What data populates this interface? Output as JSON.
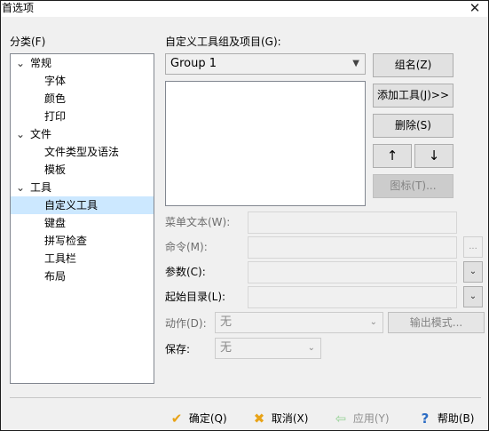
{
  "window": {
    "title": "首选项",
    "close_glyph": "✕"
  },
  "category": {
    "label": "分类(F)",
    "tree": [
      {
        "label": "常规",
        "expanded": true,
        "level": 0
      },
      {
        "label": "字体",
        "level": 1
      },
      {
        "label": "颜色",
        "level": 1
      },
      {
        "label": "打印",
        "level": 1
      },
      {
        "label": "文件",
        "expanded": true,
        "level": 0
      },
      {
        "label": "文件类型及语法",
        "level": 1
      },
      {
        "label": "模板",
        "level": 1
      },
      {
        "label": "工具",
        "expanded": true,
        "level": 0
      },
      {
        "label": "自定义工具",
        "level": 1,
        "selected": true
      },
      {
        "label": "键盘",
        "level": 1
      },
      {
        "label": "拼写检查",
        "level": 1
      },
      {
        "label": "工具栏",
        "level": 1
      },
      {
        "label": "布局",
        "level": 1
      }
    ]
  },
  "tools": {
    "group_label": "自定义工具组及项目(G):",
    "group_value": "Group 1",
    "buttons": {
      "group_name": "组名(Z)",
      "add_tool": "添加工具(J)>>",
      "delete": "删除(S)",
      "up": "↑",
      "down": "↓",
      "icon": "图标(T)..."
    },
    "fields": {
      "menu_text": "菜单文本(W):",
      "command": "命令(M):",
      "args": "参数(C):",
      "start_dir": "起始目录(L):",
      "action": "动作(D):",
      "save": "保存:"
    },
    "action_value": "无",
    "save_value": "无",
    "output_mode": "输出模式...",
    "browse": "...",
    "dropdown_glyph": "⌄"
  },
  "footer": {
    "ok": "确定(Q)",
    "cancel": "取消(X)",
    "apply": "应用(Y)",
    "help": "帮助(B)"
  },
  "colors": {
    "selection": "#cce8ff",
    "ok_icon": "#e8a317",
    "cancel_icon": "#e8a317",
    "apply_icon": "#a8d8a8",
    "help_icon": "#2b6cc4"
  }
}
